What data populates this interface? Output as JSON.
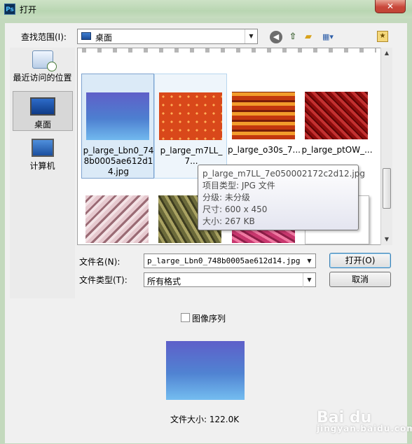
{
  "window": {
    "app_icon": "Ps",
    "title": "打开",
    "close_glyph": "✕"
  },
  "toolbar": {
    "lookin_label": "查找范围(I):",
    "lookin_value": "桌面",
    "icons": [
      "back-icon",
      "up-folder-icon",
      "new-folder-icon",
      "views-menu-icon"
    ]
  },
  "places": [
    {
      "label": "最近访问的位置",
      "icon": "recent-places-icon"
    },
    {
      "label": "桌面",
      "icon": "desktop-icon",
      "selected": true
    },
    {
      "label": "计算机",
      "icon": "computer-icon"
    }
  ],
  "files": [
    {
      "name": "p_large_Lbn0_748b0005ae612d14.jpg",
      "selected": true
    },
    {
      "name": "p_large_m7LL_7...",
      "hover": true
    },
    {
      "name": "p_large_o30s_7..."
    },
    {
      "name": "p_large_ptOW_..."
    },
    {
      "name": ""
    },
    {
      "name": ""
    },
    {
      "name": ""
    },
    {
      "name": ""
    }
  ],
  "tooltip": {
    "line1": "p_large_m7LL_7e050002172c2d12.jpg",
    "line2": "项目类型: JPG 文件",
    "line3": "分级: 未分级",
    "line4": "尺寸: 600 x 450",
    "line5": "大小: 267 KB"
  },
  "form": {
    "filename_label": "文件名(N):",
    "filename_value": "p_large_Lbn0_748b0005ae612d14.jpg",
    "filetype_label": "文件类型(T):",
    "filetype_value": "所有格式",
    "open_button": "打开(O)",
    "cancel_button": "取消"
  },
  "options": {
    "image_sequence_label": "图像序列",
    "image_sequence_checked": false
  },
  "preview": {
    "filesize_text": "文件大小: 122.0K"
  },
  "watermark": {
    "text": "Bai du",
    "sub": "jingyan.baidu.com"
  }
}
